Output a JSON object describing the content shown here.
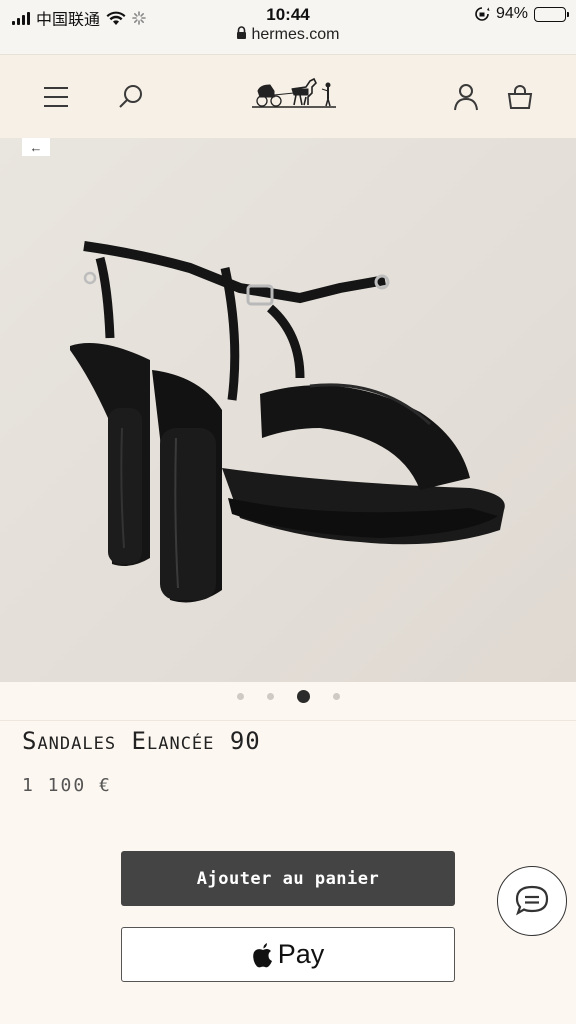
{
  "status_bar": {
    "carrier": "中国联通",
    "time": "10:44",
    "battery_percent": "94%",
    "battery_level": 0.94
  },
  "url_bar": {
    "domain": "hermes.com"
  },
  "header": {
    "menu_icon": "hamburger-icon",
    "search_icon": "search-icon",
    "logo": "hermes-carriage-logo",
    "account_icon": "user-icon",
    "cart_icon": "shopping-bag-icon"
  },
  "gallery": {
    "back_label": "←",
    "total_images": 4,
    "active_index": 2
  },
  "product": {
    "name": "Sandales Elancée 90",
    "price": "1 100 €"
  },
  "actions": {
    "add_to_cart": "Ajouter au panier",
    "apple_pay": "Pay"
  },
  "colors": {
    "header_bg": "#f7f0e6",
    "page_bg": "#fcf7f1",
    "primary_button": "#444444"
  }
}
